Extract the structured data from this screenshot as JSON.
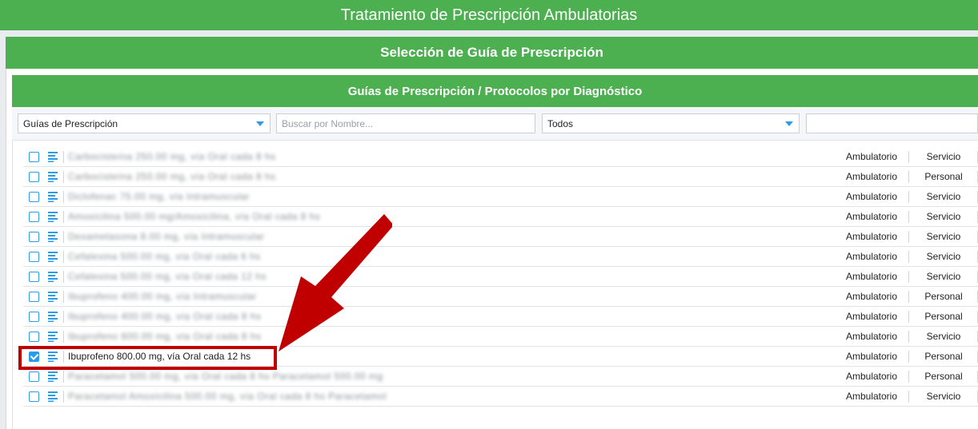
{
  "window": {
    "title": "Tratamiento de Prescripción Ambulatorias"
  },
  "selection": {
    "title": "Selección de Guía de Prescripción"
  },
  "guides": {
    "title": "Guías de Prescripción / Protocolos por Diagnóstico"
  },
  "filters": {
    "guide_type_select": "Guías de Prescripción",
    "search_placeholder": "Buscar por Nombre...",
    "scope_select": "Todos"
  },
  "rows": [
    {
      "name": "Carbocisteína 250.00 mg, vía Oral cada 8 hs",
      "type": "Ambulatorio",
      "scope": "Servicio",
      "checked": false,
      "redacted": true
    },
    {
      "name": "Carbocisteína 250.00 mg, vía Oral cada 8 hs",
      "type": "Ambulatorio",
      "scope": "Personal",
      "checked": false,
      "redacted": true
    },
    {
      "name": "Diclofenac 75.00 mg, vía Intramuscular",
      "type": "Ambulatorio",
      "scope": "Servicio",
      "checked": false,
      "redacted": true
    },
    {
      "name": "Amoxicilina 500.00 mg/Amoxicilina, vía Oral cada 8 hs",
      "type": "Ambulatorio",
      "scope": "Servicio",
      "checked": false,
      "redacted": true
    },
    {
      "name": "Dexametasona 8.00 mg, vía Intramuscular",
      "type": "Ambulatorio",
      "scope": "Servicio",
      "checked": false,
      "redacted": true
    },
    {
      "name": "Cefalexina 500.00 mg, vía Oral cada 6 hs",
      "type": "Ambulatorio",
      "scope": "Servicio",
      "checked": false,
      "redacted": true
    },
    {
      "name": "Cefalexina 500.00 mg, vía Oral cada 12 hs",
      "type": "Ambulatorio",
      "scope": "Servicio",
      "checked": false,
      "redacted": true
    },
    {
      "name": "Ibuprofeno 400.00 mg, vía Intramuscular",
      "type": "Ambulatorio",
      "scope": "Personal",
      "checked": false,
      "redacted": true
    },
    {
      "name": "Ibuprofeno 400.00 mg, vía Oral cada 8 hs",
      "type": "Ambulatorio",
      "scope": "Personal",
      "checked": false,
      "redacted": true
    },
    {
      "name": "Ibuprofeno 600.00 mg, vía Oral cada 8 hs",
      "type": "Ambulatorio",
      "scope": "Servicio",
      "checked": false,
      "redacted": true
    },
    {
      "name": "Ibuprofeno 800.00 mg, vía Oral cada 12 hs",
      "type": "Ambulatorio",
      "scope": "Personal",
      "checked": true,
      "redacted": false
    },
    {
      "name": "Paracetamol 500.00 mg, vía Oral cada 8 hs Paracetamol 500.00 mg",
      "type": "Ambulatorio",
      "scope": "Personal",
      "checked": false,
      "redacted": true
    },
    {
      "name": "Paracetamol Amoxicilina 500.00 mg, vía Oral cada 8 hs Paracetamol",
      "type": "Ambulatorio",
      "scope": "Servicio",
      "checked": false,
      "redacted": true
    }
  ],
  "colors": {
    "header_green": "#4caf50",
    "accent_blue": "#2e9be8",
    "annotation_red": "#c00000"
  }
}
